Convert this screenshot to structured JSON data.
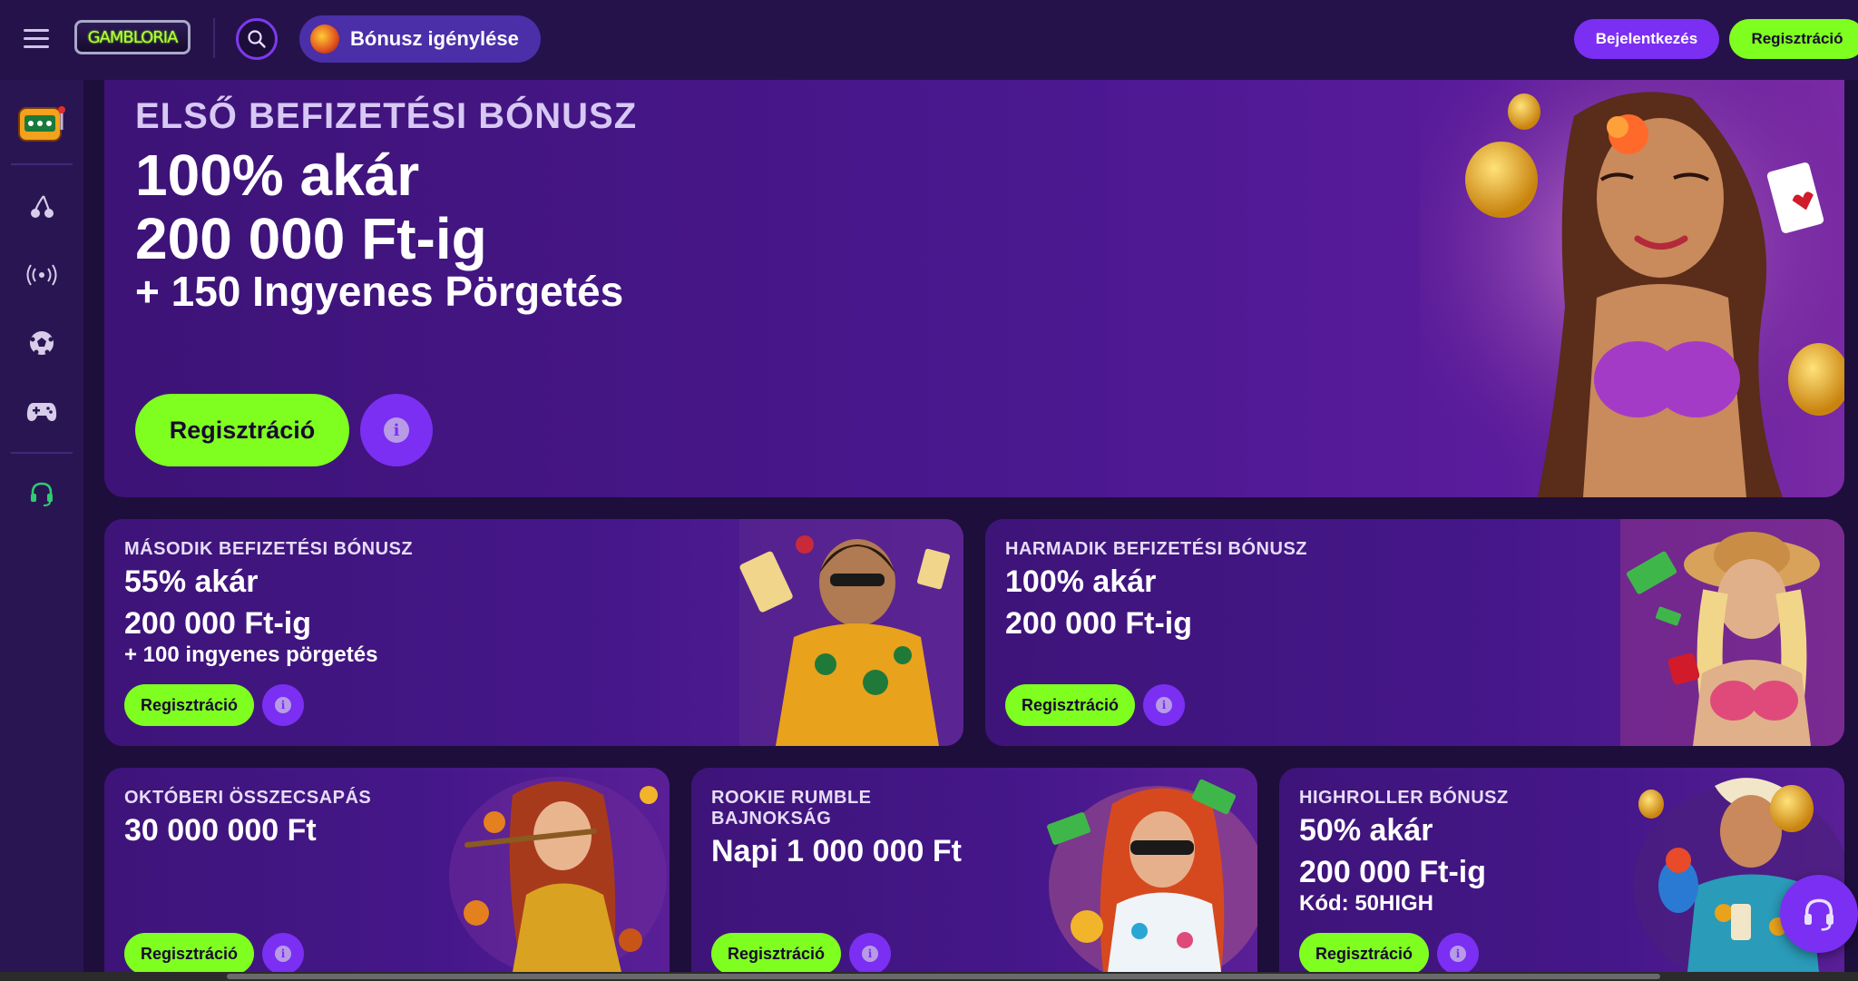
{
  "header": {
    "logo_text": "GAMBLORIA",
    "bonus_claim_label": "Bónusz igénylése",
    "login_label": "Bejelentkezés",
    "register_label": "Regisztráció"
  },
  "sidebar": {
    "items": [
      {
        "icon": "slot-machine-icon"
      },
      {
        "icon": "cherry-icon"
      },
      {
        "icon": "live-broadcast-icon"
      },
      {
        "icon": "soccer-ball-icon"
      },
      {
        "icon": "gamepad-icon"
      },
      {
        "icon": "headset-icon"
      }
    ]
  },
  "hero": {
    "kicker": "ELSŐ BEFIZETÉSI BÓNUSZ",
    "line1": "100% akár",
    "line2": "200 000 Ft-ig",
    "line3": "+ 150 Ingyenes Pörgetés",
    "register_label": "Regisztráció",
    "info_symbol": "i"
  },
  "cards": [
    {
      "kicker": "MÁSODIK BEFIZETÉSI BÓNUSZ",
      "line1": "55% akár",
      "line2": "200 000 Ft-ig",
      "line3": "+ 100 ingyenes pörgetés",
      "register_label": "Regisztráció",
      "info_symbol": "i"
    },
    {
      "kicker": "HARMADIK BEFIZETÉSI BÓNUSZ",
      "line1": "100% akár",
      "line2": "200 000 Ft-ig",
      "register_label": "Regisztráció",
      "info_symbol": "i"
    },
    {
      "kicker": "OKTÓBERI ÖSSZECSAPÁS",
      "line1": "30 000 000 Ft",
      "register_label": "Regisztráció",
      "info_symbol": "i"
    },
    {
      "kicker_line1": "ROOKIE RUMBLE",
      "kicker_line2": "BAJNOKSÁG",
      "line1": "Napi 1 000 000 Ft",
      "register_label": "Regisztráció",
      "info_symbol": "i"
    },
    {
      "kicker": "HIGHROLLER BÓNUSZ",
      "line1": "50% akár",
      "line2": "200 000 Ft-ig",
      "line3": "Kód: 50HIGH",
      "register_label": "Regisztráció",
      "info_symbol": "i"
    }
  ],
  "colors": {
    "accent_green": "#7fff1f",
    "accent_purple": "#7b2ff2",
    "background": "#1e0e3c"
  }
}
